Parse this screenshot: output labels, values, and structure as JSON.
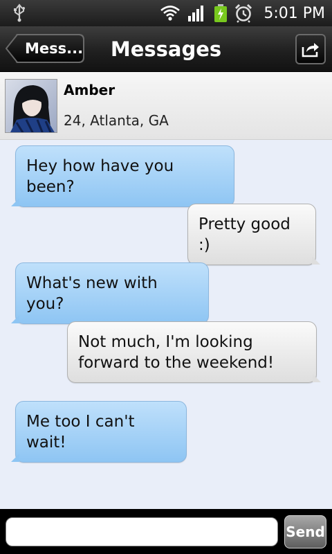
{
  "status_bar": {
    "time": "5:01 PM",
    "icons": [
      "usb-icon",
      "wifi-icon",
      "signal-icon",
      "battery-charging-icon",
      "alarm-icon"
    ]
  },
  "action_bar": {
    "back_label": "Mess...",
    "title": "Messages",
    "share_icon": "share-icon"
  },
  "contact": {
    "name": "Amber",
    "info": "24, Atlanta, GA"
  },
  "messages": [
    {
      "direction": "incoming",
      "text": "Hey how have you been?"
    },
    {
      "direction": "outgoing",
      "text": "Pretty good :)"
    },
    {
      "direction": "incoming",
      "text": "What's new with you?"
    },
    {
      "direction": "outgoing",
      "text": "Not much, I'm looking forward to the weekend!"
    },
    {
      "direction": "incoming",
      "text": "Me too I can't wait!"
    }
  ],
  "composer": {
    "input_value": "",
    "send_label": "Send"
  },
  "colors": {
    "incoming_bubble": "#a6d1f7",
    "outgoing_bubble": "#ececec",
    "chat_background": "#e9eef9"
  }
}
